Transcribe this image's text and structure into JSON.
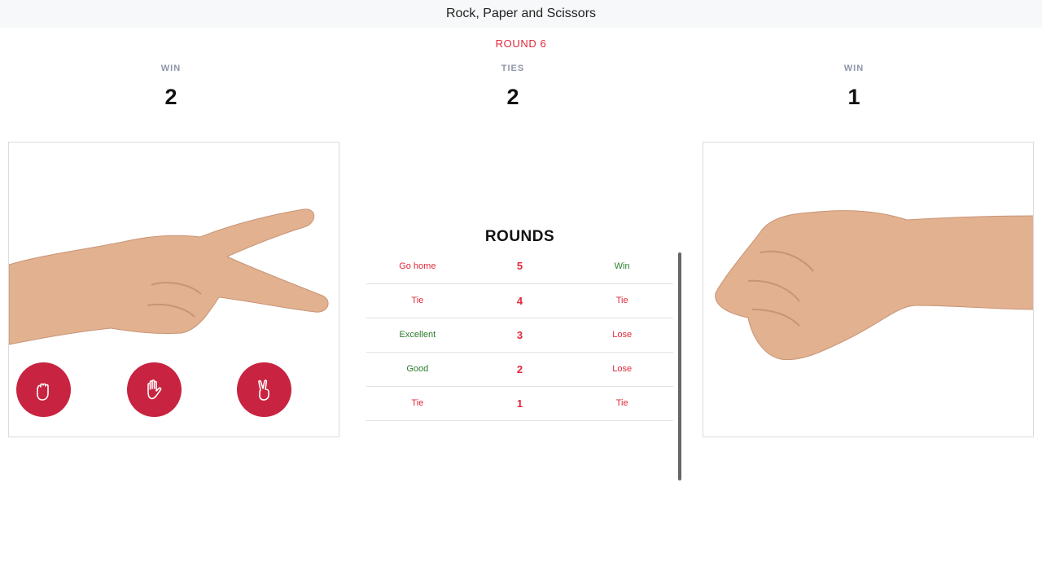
{
  "header": {
    "title": "Rock, Paper and Scissors"
  },
  "round": {
    "label": "ROUND 6"
  },
  "scores": {
    "player": {
      "caption": "WIN",
      "value": "2"
    },
    "ties": {
      "caption": "TIES",
      "value": "2"
    },
    "computer": {
      "caption": "WIN",
      "value": "1"
    }
  },
  "player_card": {
    "hand": "scissors-hand-image",
    "choices": [
      {
        "icon": "rock-icon"
      },
      {
        "icon": "paper-icon"
      },
      {
        "icon": "scissors-icon"
      }
    ]
  },
  "computer_card": {
    "hand": "rock-fist-image"
  },
  "rounds": {
    "heading": "ROUNDS",
    "rows": [
      {
        "left": "Go home",
        "number": "5",
        "right": "Win",
        "left_color": "red",
        "right_color": "green"
      },
      {
        "left": "Tie",
        "number": "4",
        "right": "Tie",
        "left_color": "red",
        "right_color": "red"
      },
      {
        "left": "Excellent",
        "number": "3",
        "right": "Lose",
        "left_color": "green",
        "right_color": "red"
      },
      {
        "left": "Good",
        "number": "2",
        "right": "Lose",
        "left_color": "green",
        "right_color": "red"
      },
      {
        "left": "Tie",
        "number": "1",
        "right": "Tie",
        "left_color": "red",
        "right_color": "red"
      }
    ]
  },
  "colors": {
    "accent": "#c82340",
    "red": "#e0283b",
    "green": "#2a7d2a"
  }
}
